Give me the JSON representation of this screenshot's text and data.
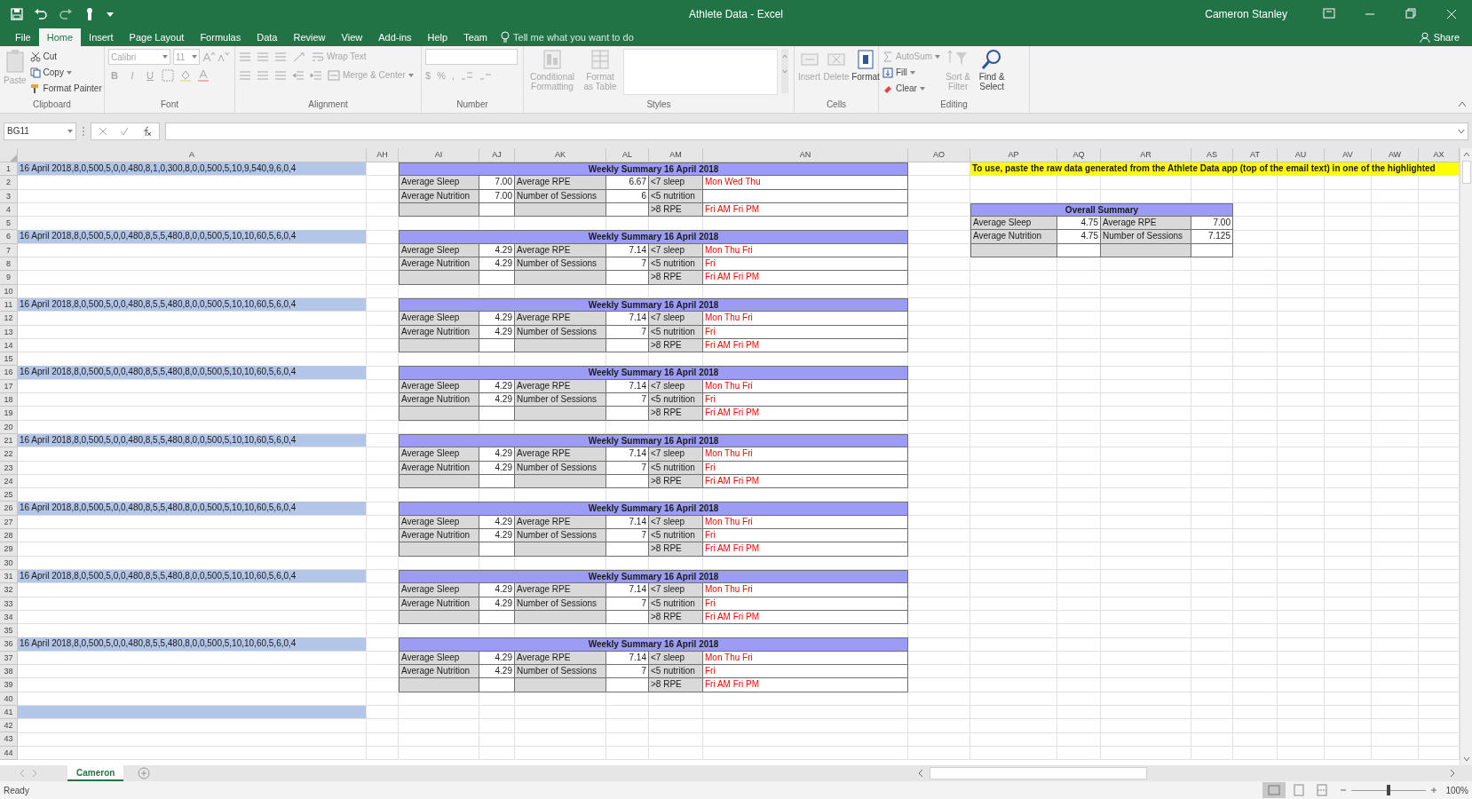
{
  "window": {
    "title": "Athlete Data - Excel",
    "user": "Cameron Stanley"
  },
  "tabs": [
    {
      "label": "File",
      "selected": false
    },
    {
      "label": "Home",
      "selected": true
    },
    {
      "label": "Insert",
      "selected": false
    },
    {
      "label": "Page Layout",
      "selected": false
    },
    {
      "label": "Formulas",
      "selected": false
    },
    {
      "label": "Data",
      "selected": false
    },
    {
      "label": "Review",
      "selected": false
    },
    {
      "label": "View",
      "selected": false
    },
    {
      "label": "Add-ins",
      "selected": false
    },
    {
      "label": "Help",
      "selected": false
    },
    {
      "label": "Team",
      "selected": false
    }
  ],
  "tell_me": "Tell me what you want to do",
  "share": "Share",
  "ribbon": {
    "groups": [
      {
        "name": "Clipboard",
        "commands": [
          {
            "label": "Paste",
            "disabled": true
          },
          {
            "label": "Cut",
            "disabled": false
          },
          {
            "label": "Copy",
            "disabled": false
          },
          {
            "label": "Format Painter",
            "disabled": false
          }
        ]
      },
      {
        "name": "Font",
        "font": "Calibri",
        "size": "11",
        "commands": [
          {
            "label": "B",
            "disabled": true
          },
          {
            "label": "I",
            "disabled": true
          },
          {
            "label": "U",
            "disabled": true
          }
        ]
      },
      {
        "name": "Alignment",
        "commands": [
          {
            "label": "Wrap Text",
            "disabled": true
          },
          {
            "label": "Merge & Center",
            "disabled": true
          }
        ]
      },
      {
        "name": "Number",
        "commands": [
          {
            "label": "$",
            "disabled": true
          },
          {
            "label": "%",
            "disabled": true
          },
          {
            "label": ",",
            "disabled": true
          }
        ]
      },
      {
        "name": "Styles",
        "commands": [
          {
            "label": "Conditional Formatting",
            "disabled": true
          },
          {
            "label": "Format as Table",
            "disabled": true
          }
        ]
      },
      {
        "name": "Cells",
        "commands": [
          {
            "label": "Insert",
            "disabled": true
          },
          {
            "label": "Delete",
            "disabled": true
          },
          {
            "label": "Format",
            "disabled": false
          }
        ]
      },
      {
        "name": "Editing",
        "commands": [
          {
            "label": "AutoSum",
            "disabled": true
          },
          {
            "label": "Fill",
            "disabled": false
          },
          {
            "label": "Clear",
            "disabled": false
          },
          {
            "label": "Sort & Filter",
            "disabled": true
          },
          {
            "label": "Find & Select",
            "disabled": false
          }
        ]
      }
    ]
  },
  "formula_bar": {
    "name_box": "BG11"
  },
  "sheet": {
    "columns": [
      "A",
      "AH",
      "AI",
      "AJ",
      "AK",
      "AL",
      "AM",
      "AN",
      "AO",
      "AP",
      "AQ",
      "AR",
      "AS",
      "AT",
      "AU",
      "AV",
      "AW",
      "AX"
    ],
    "rows": [
      "1",
      "2",
      "3",
      "4",
      "5",
      "6",
      "7",
      "8",
      "9",
      "10",
      "11",
      "12",
      "13",
      "14",
      "15",
      "16",
      "17",
      "18",
      "19",
      "20",
      "21",
      "22",
      "23",
      "24",
      "25",
      "26",
      "27",
      "28",
      "29",
      "30",
      "31",
      "32",
      "33",
      "34",
      "35",
      "36",
      "37",
      "38",
      "39",
      "40",
      "41",
      "42",
      "43",
      "44"
    ],
    "raw_data": [
      {
        "highlighted": true,
        "text": "16 April 2018,8,0,500,5,0,0,480,8,1,0,300,8,0,0,500,5,10,9,540,9,6,0,4"
      },
      {
        "highlighted": true,
        "text": "16 April 2018,8,0,500,5,0,0,480,8,5,5,480,8,0,0,500,5,10,10,60,5,6,0,4"
      },
      {
        "highlighted": true,
        "text": "16 April 2018,8,0,500,5,0,0,480,8,5,5,480,8,0,0,500,5,10,10,60,5,6,0,4"
      },
      {
        "highlighted": true,
        "text": "16 April 2018,8,0,500,5,0,0,480,8,5,5,480,8,0,0,500,5,10,10,60,5,6,0,4"
      },
      {
        "highlighted": true,
        "text": "16 April 2018,8,0,500,5,0,0,480,8,5,5,480,8,0,0,500,5,10,10,60,5,6,0,4"
      },
      {
        "highlighted": true,
        "text": "16 April 2018,8,0,500,5,0,0,480,8,5,5,480,8,0,0,500,5,10,10,60,5,6,0,4"
      },
      {
        "highlighted": true,
        "text": "16 April 2018,8,0,500,5,0,0,480,8,5,5,480,8,0,0,500,5,10,10,60,5,6,0,4"
      },
      {
        "highlighted": true,
        "text": "16 April 2018,8,0,500,5,0,0,480,8,5,5,480,8,0,0,500,5,10,10,60,5,6,0,4"
      },
      {
        "highlighted": true
      }
    ],
    "weekly_summaries": [
      {
        "title": "Weekly Summary 16 April 2018",
        "rows": [
          {
            "label_1": "Average Sleep",
            "value_1": "7.00",
            "label_2": "Average RPE",
            "value_2": "6.67",
            "flag": "<7 sleep",
            "days": "Mon Wed Thu"
          },
          {
            "label_1": "Average Nutrition",
            "value_1": "7.00",
            "label_2": "Number of Sessions",
            "value_2": "6",
            "flag": "<5 nutrition"
          },
          {
            "flag": ">8 RPE",
            "days": "Fri AM Fri PM"
          }
        ]
      },
      {
        "title": "Weekly Summary 16 April 2018",
        "rows": [
          {
            "label_1": "Average Sleep",
            "value_1": "4.29",
            "label_2": "Average RPE",
            "value_2": "7.14",
            "flag": "<7 sleep",
            "days": "Mon Thu Fri"
          },
          {
            "label_1": "Average Nutrition",
            "value_1": "4.29",
            "label_2": "Number of Sessions",
            "value_2": "7",
            "flag": "<5 nutrition",
            "days": "Fri"
          },
          {
            "flag": ">8 RPE",
            "days": "Fri AM Fri PM"
          }
        ]
      },
      {
        "title": "Weekly Summary 16 April 2018",
        "rows": [
          {
            "label_1": "Average Sleep",
            "value_1": "4.29",
            "label_2": "Average RPE",
            "value_2": "7.14",
            "flag": "<7 sleep",
            "days": "Mon Thu Fri"
          },
          {
            "label_1": "Average Nutrition",
            "value_1": "4.29",
            "label_2": "Number of Sessions",
            "value_2": "7",
            "flag": "<5 nutrition",
            "days": "Fri"
          },
          {
            "flag": ">8 RPE",
            "days": "Fri AM Fri PM"
          }
        ]
      },
      {
        "title": "Weekly Summary 16 April 2018",
        "rows": [
          {
            "label_1": "Average Sleep",
            "value_1": "4.29",
            "label_2": "Average RPE",
            "value_2": "7.14",
            "flag": "<7 sleep",
            "days": "Mon Thu Fri"
          },
          {
            "label_1": "Average Nutrition",
            "value_1": "4.29",
            "label_2": "Number of Sessions",
            "value_2": "7",
            "flag": "<5 nutrition",
            "days": "Fri"
          },
          {
            "flag": ">8 RPE",
            "days": "Fri AM Fri PM"
          }
        ]
      },
      {
        "title": "Weekly Summary 16 April 2018",
        "rows": [
          {
            "label_1": "Average Sleep",
            "value_1": "4.29",
            "label_2": "Average RPE",
            "value_2": "7.14",
            "flag": "<7 sleep",
            "days": "Mon Thu Fri"
          },
          {
            "label_1": "Average Nutrition",
            "value_1": "4.29",
            "label_2": "Number of Sessions",
            "value_2": "7",
            "flag": "<5 nutrition",
            "days": "Fri"
          },
          {
            "flag": ">8 RPE",
            "days": "Fri AM Fri PM"
          }
        ]
      },
      {
        "title": "Weekly Summary 16 April 2018",
        "rows": [
          {
            "label_1": "Average Sleep",
            "value_1": "4.29",
            "label_2": "Average RPE",
            "value_2": "7.14",
            "flag": "<7 sleep",
            "days": "Mon Thu Fri"
          },
          {
            "label_1": "Average Nutrition",
            "value_1": "4.29",
            "label_2": "Number of Sessions",
            "value_2": "7",
            "flag": "<5 nutrition",
            "days": "Fri"
          },
          {
            "flag": ">8 RPE",
            "days": "Fri AM Fri PM"
          }
        ]
      },
      {
        "title": "Weekly Summary 16 April 2018",
        "rows": [
          {
            "label_1": "Average Sleep",
            "value_1": "4.29",
            "label_2": "Average RPE",
            "value_2": "7.14",
            "flag": "<7 sleep",
            "days": "Mon Thu Fri"
          },
          {
            "label_1": "Average Nutrition",
            "value_1": "4.29",
            "label_2": "Number of Sessions",
            "value_2": "7",
            "flag": "<5 nutrition",
            "days": "Fri"
          },
          {
            "flag": ">8 RPE",
            "days": "Fri AM Fri PM"
          }
        ]
      },
      {
        "title": "Weekly Summary 16 April 2018",
        "rows": [
          {
            "label_1": "Average Sleep",
            "value_1": "4.29",
            "label_2": "Average RPE",
            "value_2": "7.14",
            "flag": "<7 sleep",
            "days": "Mon Thu Fri"
          },
          {
            "label_1": "Average Nutrition",
            "value_1": "4.29",
            "label_2": "Number of Sessions",
            "value_2": "7",
            "flag": "<5 nutrition",
            "days": "Fri"
          },
          {
            "flag": ">8 RPE",
            "days": "Fri AM Fri PM"
          }
        ]
      }
    ],
    "overall_summary": {
      "title": "Overall Summary",
      "rows": [
        {
          "label_1": "Average Sleep",
          "value_1": "4.75",
          "label_2": "Average RPE",
          "value_2": "7.00"
        },
        {
          "label_1": "Average Nutrition",
          "value_1": "4.75",
          "label_2": "Number of Sessions",
          "value_2": "7.125"
        },
        {}
      ]
    },
    "note": "To use, paste the raw data generated from the Athlete Data app (top of the email text) in one of the highlighted"
  },
  "sheet_tabs": [
    {
      "label": "Cameron",
      "selected": true
    }
  ],
  "status_bar": {
    "status": "Ready",
    "zoom": {
      "level": 0.5,
      "reading": "100%"
    }
  }
}
